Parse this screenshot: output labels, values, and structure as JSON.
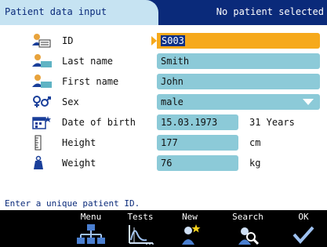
{
  "window": {
    "title": "Patient data input",
    "status": "No patient selected"
  },
  "form": {
    "rows": [
      {
        "label": "ID",
        "value": "S003",
        "icon": "id-card-person-icon",
        "focused": true
      },
      {
        "label": "Last name",
        "value": "Smith",
        "icon": "person-card-icon"
      },
      {
        "label": "First name",
        "value": "John",
        "icon": "person-card-icon"
      },
      {
        "label": "Sex",
        "value": "male",
        "icon": "gender-icon",
        "control": "dropdown"
      },
      {
        "label": "Date of birth",
        "value": "15.03.1973",
        "suffix": "31 Years",
        "icon": "calendar-icon"
      },
      {
        "label": "Height",
        "value": "177",
        "suffix": "cm",
        "icon": "height-icon"
      },
      {
        "label": "Weight",
        "value": "76",
        "suffix": "kg",
        "icon": "weight-icon"
      }
    ]
  },
  "hint": "Enter a unique patient ID.",
  "toolbar": {
    "buttons": [
      {
        "label": "Menu",
        "icon": "menu-tree-icon"
      },
      {
        "label": "Tests",
        "icon": "tests-chart-icon"
      },
      {
        "label": "New",
        "icon": "new-patient-icon"
      },
      {
        "label": "Search",
        "icon": "search-patient-icon"
      },
      {
        "label": "OK",
        "icon": "checkmark-icon"
      }
    ]
  },
  "colors": {
    "title_bar": "#0a2a7a",
    "title_tab": "#c6e3f2",
    "field": "#8ccad8",
    "focus": "#f6a91c",
    "selection": "#0b2f86",
    "toolbar": "#000000"
  }
}
